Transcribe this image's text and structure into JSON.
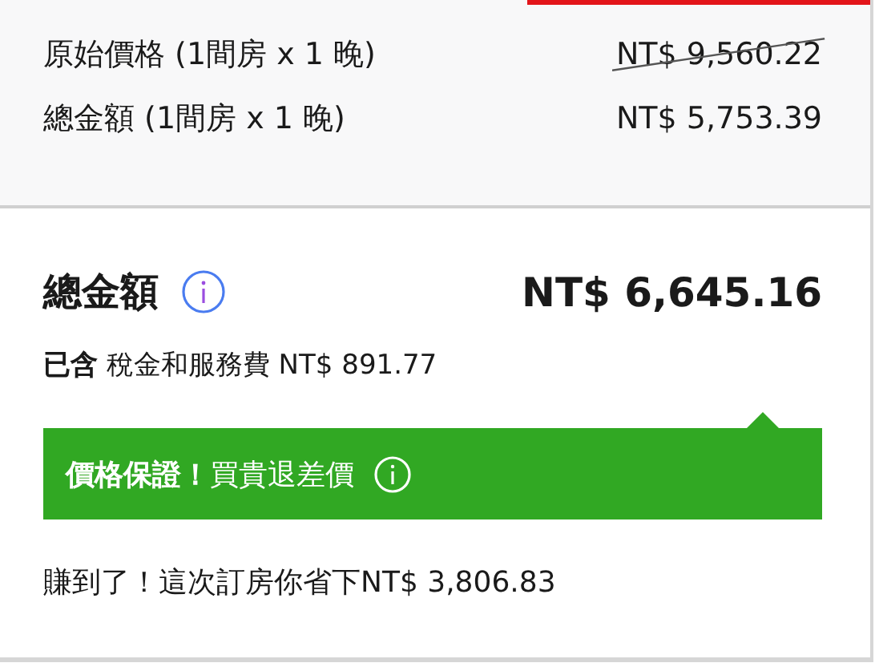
{
  "summary_rows": [
    {
      "label": "原始價格 (1間房 x 1 晚)",
      "price": "NT$ 9,560.22",
      "struck": true
    },
    {
      "label": "總金額 (1間房 x 1 晚)",
      "price": "NT$ 5,753.39",
      "struck": false
    }
  ],
  "total": {
    "label": "總金額",
    "price": "NT$ 6,645.16",
    "tax_note": "**已含** 稅金和服務費 NT$ 891.77"
  },
  "guarantee": {
    "text": "**價格保證！**買貴退差價"
  },
  "savings": "賺到了！這次訂房你省下NT$ 3,806.83"
}
